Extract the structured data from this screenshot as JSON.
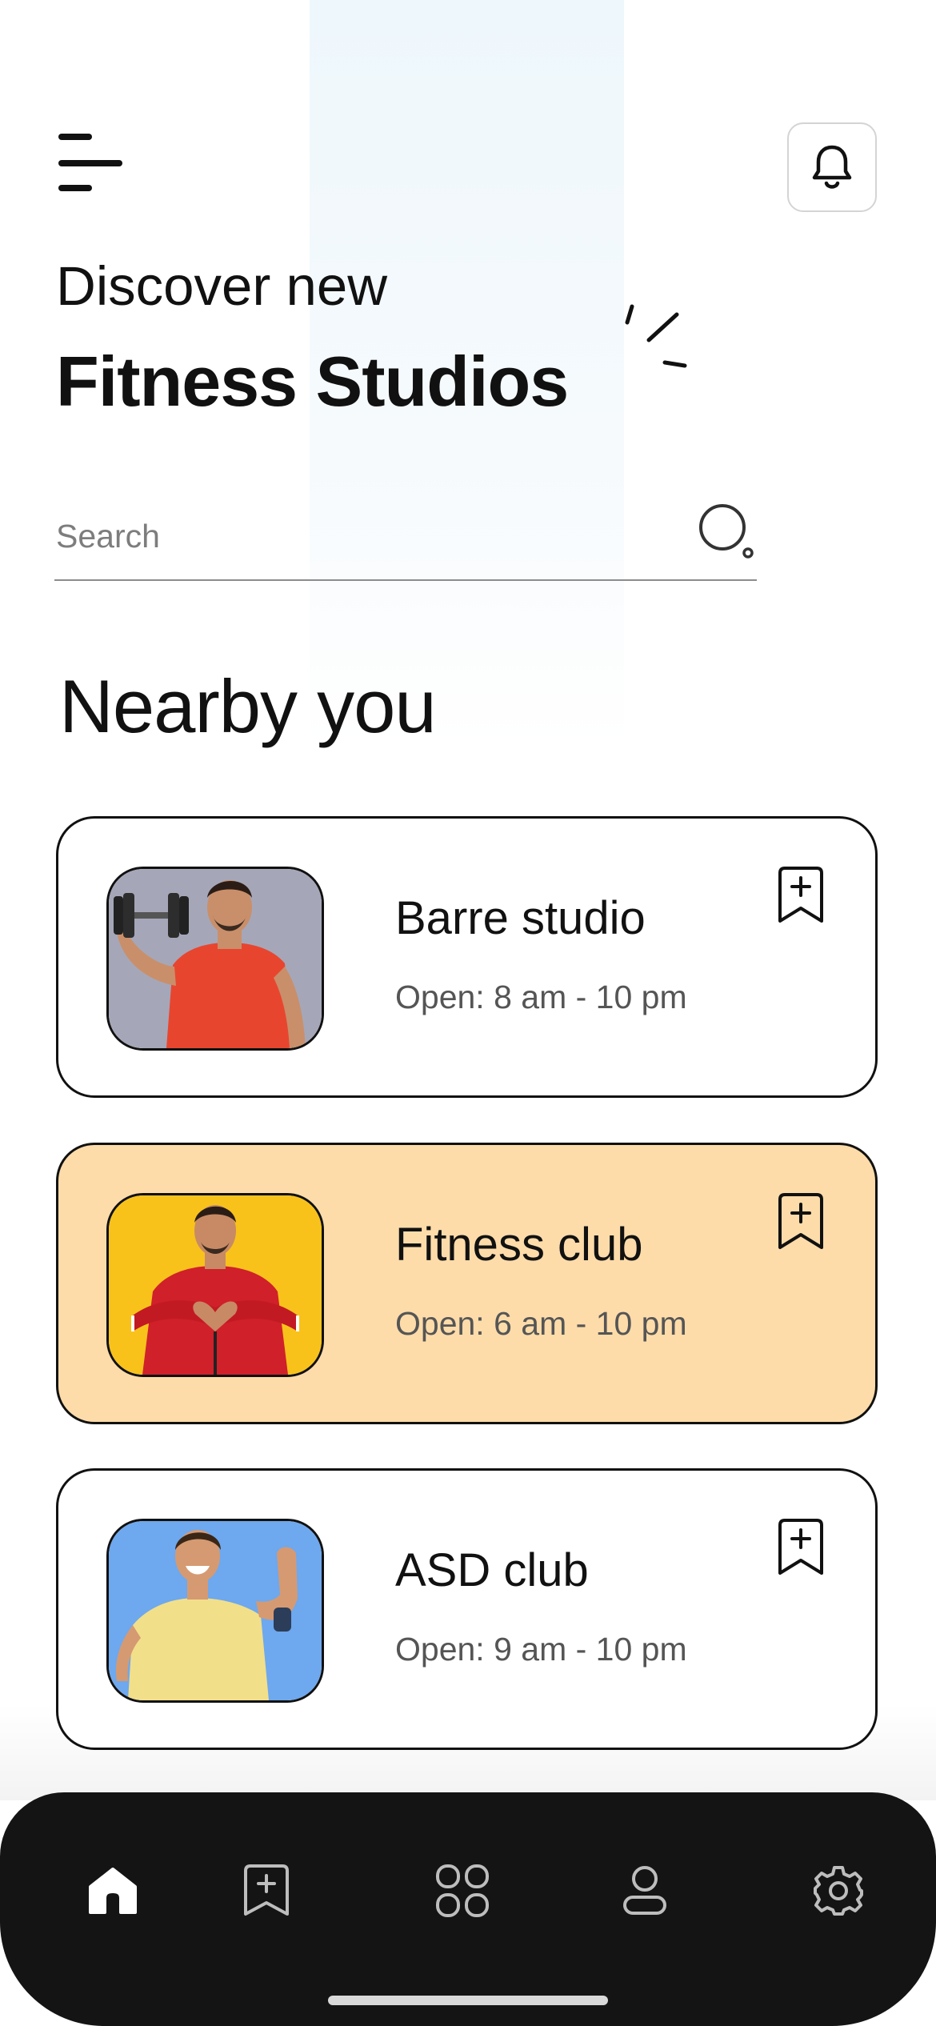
{
  "header": {
    "title_line1": "Discover new",
    "title_line2": "Fitness Studios"
  },
  "search": {
    "placeholder": "Search",
    "value": ""
  },
  "section": {
    "title": "Nearby you"
  },
  "studios": [
    {
      "name": "Barre studio",
      "hours": "Open: 8 am - 10 pm",
      "highlighted": false,
      "photo": "man-lifting-dumbbell",
      "photo_bg": "#a5a7b8"
    },
    {
      "name": "Fitness club",
      "hours": "Open: 6 am - 10 pm",
      "highlighted": true,
      "photo": "man-heart-hands",
      "photo_bg": "#f8c21b"
    },
    {
      "name": "ASD club",
      "hours": "Open: 9 am - 10 pm",
      "highlighted": false,
      "photo": "man-flexing-arm",
      "photo_bg": "#6ea8ee"
    }
  ],
  "tabbar": {
    "items": [
      {
        "icon": "home-icon",
        "active": true
      },
      {
        "icon": "bookmark-plus-icon",
        "active": false
      },
      {
        "icon": "grid-icon",
        "active": false
      },
      {
        "icon": "profile-icon",
        "active": false
      },
      {
        "icon": "settings-icon",
        "active": false
      }
    ]
  },
  "colors": {
    "accent_card": "#fddcaa",
    "tabbar_bg": "#141414",
    "text": "#111111",
    "muted_text": "#555555"
  }
}
